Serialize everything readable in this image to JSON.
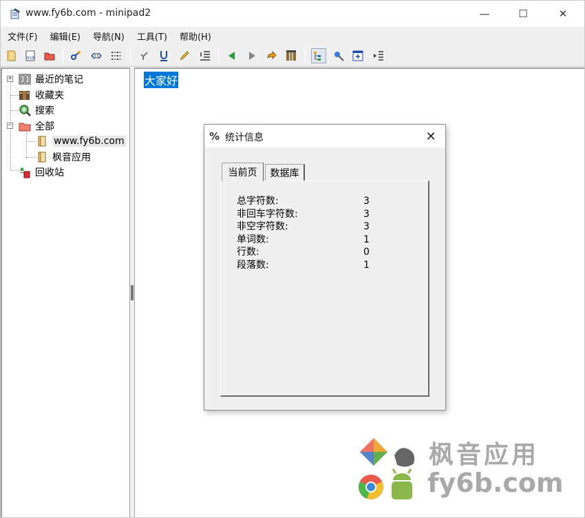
{
  "window": {
    "title": "www.fy6b.com - minipad2",
    "minimize_glyph": "—",
    "maximize_glyph": "☐",
    "close_glyph": "✕"
  },
  "menu": [
    "文件(F)",
    "编辑(E)",
    "导航(N)",
    "工具(T)",
    "帮助(H)"
  ],
  "toolbar": {
    "icons": [
      "new-note-icon",
      "binary-note-icon",
      "folder-icon",
      "key-icon",
      "tag-icon",
      "list-icon",
      "undo-icon",
      "underline-icon",
      "highlighter-icon",
      "numbered-list-icon",
      "back-icon",
      "forward-icon",
      "up-icon",
      "columns-icon",
      "tree-view-icon",
      "pin-icon",
      "window-icon",
      "indent-icon"
    ]
  },
  "tree": {
    "items": [
      {
        "label": "最近的笔记",
        "icon": "recent-notes-icon"
      },
      {
        "label": "收藏夹",
        "icon": "favorites-icon"
      },
      {
        "label": "搜索",
        "icon": "search-icon"
      },
      {
        "label": "全部",
        "icon": "folder-icon"
      },
      {
        "label": "www.fy6b.com",
        "icon": "page-icon"
      },
      {
        "label": "枫音应用",
        "icon": "page-icon"
      },
      {
        "label": "回收站",
        "icon": "recycle-bin-icon"
      }
    ],
    "expand_glyph": "+",
    "collapse_glyph": "−"
  },
  "editor": {
    "content": "大家好"
  },
  "dialog": {
    "icon_glyph": "%",
    "title": "统计信息",
    "close_glyph": "✕",
    "tabs": [
      "当前页",
      "数据库"
    ],
    "stats": [
      {
        "label": "总字符数:",
        "value": "3"
      },
      {
        "label": "非回车字符数:",
        "value": "3"
      },
      {
        "label": "非空字符数:",
        "value": "3"
      },
      {
        "label": "单词数:",
        "value": "1"
      },
      {
        "label": "行数:",
        "value": "0"
      },
      {
        "label": "段落数:",
        "value": "1"
      }
    ]
  },
  "watermark": {
    "name": "枫音应用",
    "url": "fy6b.com"
  },
  "colors": {
    "selection": "#0078d7",
    "chrome": "#f0f0f0",
    "watermark": "#a9a9a9"
  }
}
